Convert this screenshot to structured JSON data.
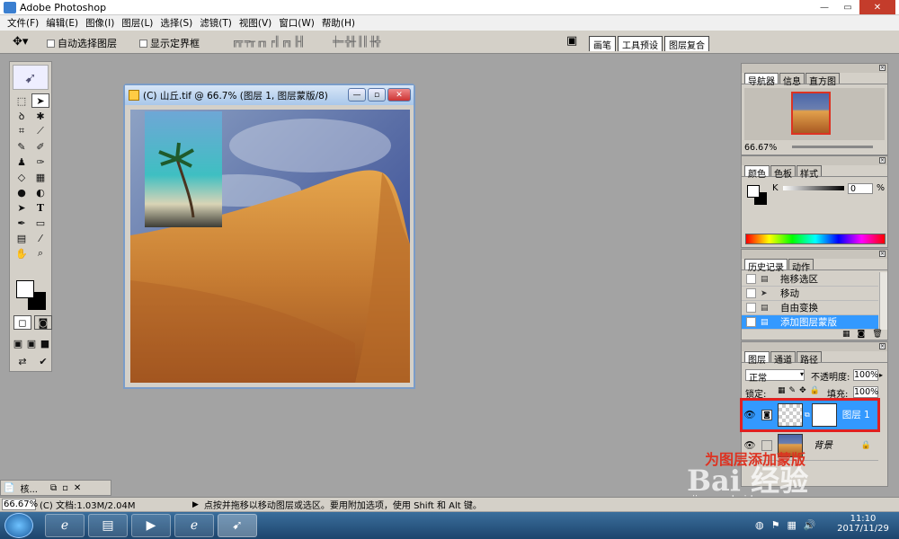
{
  "app": {
    "title": "Adobe Photoshop"
  },
  "menu": [
    "文件(F)",
    "编辑(E)",
    "图像(I)",
    "图层(L)",
    "选择(S)",
    "滤镜(T)",
    "视图(V)",
    "窗口(W)",
    "帮助(H)"
  ],
  "options": {
    "auto_select": "自动选择图层",
    "show_bounds": "显示定界框"
  },
  "palette_well": [
    "画笔",
    "工具预设",
    "图层复合"
  ],
  "document": {
    "title": "(C) 山丘.tif @ 66.7% (图层 1, 图层蒙版/8)"
  },
  "minimized_doc": {
    "label": "核..."
  },
  "navigator": {
    "tabs": [
      "导航器",
      "信息",
      "直方图"
    ],
    "zoom": "66.67%"
  },
  "color": {
    "tabs": [
      "颜色",
      "色板",
      "样式"
    ],
    "channel": "K",
    "value": "0",
    "unit": "%"
  },
  "history": {
    "tabs": [
      "历史记录",
      "动作"
    ],
    "items": [
      "拖移选区",
      "移动",
      "自由变换",
      "添加图层蒙版"
    ],
    "active_index": 3
  },
  "layers": {
    "tabs": [
      "图层",
      "通道",
      "路径"
    ],
    "blend_mode": "正常",
    "opacity_label": "不透明度:",
    "opacity": "100%",
    "lock_label": "锁定:",
    "fill_label": "填充:",
    "fill": "100%",
    "items": [
      {
        "name": "图层 1",
        "selected": true
      },
      {
        "name": "背景",
        "italic": true
      }
    ]
  },
  "status": {
    "zoom": "66.67%",
    "doc_info": "(C) 文档:1.03M/2.04M",
    "hint": "点按并拖移以移动图层或选区。要用附加选项，使用 Shift 和 Alt 键。"
  },
  "annotation": "为图层添加蒙版",
  "watermark": {
    "brand": "Bai 经验",
    "url": "jingyan.baidu.com"
  },
  "taskbar": {
    "time": "11:10",
    "date": "2017/11/29"
  },
  "colors": {
    "accent": "#3399ff",
    "highlight_border": "#e02020",
    "sand": "#d38a3a"
  }
}
